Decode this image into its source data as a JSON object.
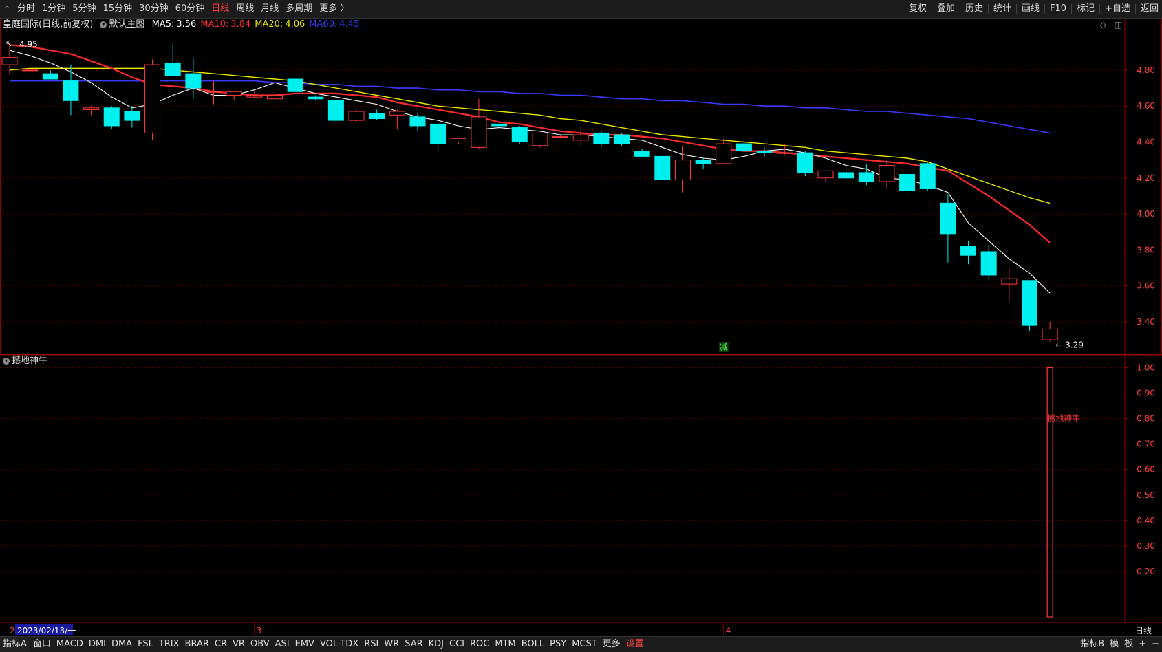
{
  "topbar": {
    "back_glyph": "⌃",
    "periods": [
      "分时",
      "1分钟",
      "5分钟",
      "15分钟",
      "30分钟",
      "60分钟",
      "日线",
      "周线",
      "月线",
      "多周期",
      "更多 〉"
    ],
    "active_period": "日线",
    "tools": [
      "复权",
      "叠加",
      "历史",
      "统计",
      "画线",
      "F10",
      "标记",
      "+自选",
      "返回"
    ]
  },
  "main_legend": {
    "title": "皇庭国际(日线,前复权)",
    "template": "默认主图",
    "ma": [
      {
        "label": "MA5:",
        "value": "3.56",
        "color": "#ffffff"
      },
      {
        "label": "MA10:",
        "value": "3.84",
        "color": "#ff2a2a"
      },
      {
        "label": "MA20:",
        "value": "4.06",
        "color": "#e8e800"
      },
      {
        "label": "MA60:",
        "value": "4.45",
        "color": "#3a3aff"
      }
    ],
    "icon_diamond": "◇",
    "icon_window": "◫"
  },
  "sub_legend": {
    "title": "撼地神牛"
  },
  "colors": {
    "up": "#ff3b3b",
    "down": "#00f0f0",
    "grid": "#5a0000",
    "border": "#9a0000",
    "axis_text": "#ff4040",
    "bg": "#000000"
  },
  "chart_data": {
    "type": "candlestick",
    "max_label": "4.95",
    "min_label": "3.29",
    "price_ticks": [
      "4.80",
      "4.60",
      "4.40",
      "4.20",
      "4.00",
      "3.80",
      "3.60",
      "3.40"
    ],
    "price_range": [
      3.22,
      5.01
    ],
    "ma5": [
      4.91,
      4.88,
      4.84,
      4.79,
      4.73,
      4.65,
      4.59,
      4.61,
      4.66,
      4.7,
      4.66,
      4.66,
      4.69,
      4.73,
      4.7,
      4.67,
      4.65,
      4.63,
      4.61,
      4.57,
      4.54,
      4.52,
      4.49,
      4.47,
      4.48,
      4.47,
      4.46,
      4.44,
      4.44,
      4.43,
      4.42,
      4.41,
      4.37,
      4.33,
      4.31,
      4.3,
      4.32,
      4.35,
      4.36,
      4.34,
      4.31,
      4.27,
      4.25,
      4.2,
      4.19,
      4.16,
      4.12,
      3.95,
      3.85,
      3.75,
      3.67,
      3.56
    ],
    "ma10": [
      4.94,
      4.93,
      4.91,
      4.89,
      4.85,
      4.81,
      4.76,
      4.72,
      4.71,
      4.7,
      4.68,
      4.67,
      4.66,
      4.66,
      4.67,
      4.67,
      4.67,
      4.66,
      4.65,
      4.62,
      4.6,
      4.58,
      4.56,
      4.54,
      4.51,
      4.5,
      4.48,
      4.46,
      4.45,
      4.44,
      4.44,
      4.43,
      4.42,
      4.4,
      4.38,
      4.36,
      4.35,
      4.35,
      4.34,
      4.33,
      4.32,
      4.31,
      4.3,
      4.29,
      4.28,
      4.26,
      4.24,
      4.17,
      4.1,
      4.02,
      3.94,
      3.84
    ],
    "ma20": [
      4.8,
      4.81,
      4.81,
      4.81,
      4.81,
      4.81,
      4.81,
      4.81,
      4.8,
      4.79,
      4.78,
      4.77,
      4.76,
      4.75,
      4.74,
      4.72,
      4.7,
      4.68,
      4.66,
      4.64,
      4.62,
      4.6,
      4.59,
      4.58,
      4.57,
      4.56,
      4.55,
      4.53,
      4.52,
      4.5,
      4.48,
      4.46,
      4.44,
      4.43,
      4.42,
      4.41,
      4.4,
      4.39,
      4.38,
      4.37,
      4.35,
      4.34,
      4.33,
      4.32,
      4.31,
      4.29,
      4.25,
      4.21,
      4.17,
      4.13,
      4.09,
      4.06
    ],
    "ma60": [
      4.74,
      4.74,
      4.74,
      4.74,
      4.74,
      4.74,
      4.74,
      4.74,
      4.74,
      4.74,
      4.74,
      4.74,
      4.74,
      4.73,
      4.73,
      4.72,
      4.72,
      4.71,
      4.71,
      4.7,
      4.7,
      4.69,
      4.69,
      4.68,
      4.68,
      4.67,
      4.67,
      4.66,
      4.66,
      4.65,
      4.64,
      4.64,
      4.63,
      4.63,
      4.62,
      4.61,
      4.61,
      4.6,
      4.6,
      4.59,
      4.59,
      4.58,
      4.57,
      4.57,
      4.56,
      4.55,
      4.54,
      4.53,
      4.51,
      4.49,
      4.47,
      4.45
    ],
    "candles": [
      {
        "o": 4.83,
        "h": 4.95,
        "l": 4.78,
        "c": 4.87
      },
      {
        "o": 4.8,
        "h": 4.82,
        "l": 4.77,
        "c": 4.8
      },
      {
        "o": 4.78,
        "h": 4.8,
        "l": 4.75,
        "c": 4.75
      },
      {
        "o": 4.74,
        "h": 4.83,
        "l": 4.55,
        "c": 4.63
      },
      {
        "o": 4.58,
        "h": 4.6,
        "l": 4.55,
        "c": 4.59
      },
      {
        "o": 4.59,
        "h": 4.6,
        "l": 4.47,
        "c": 4.49
      },
      {
        "o": 4.57,
        "h": 4.6,
        "l": 4.48,
        "c": 4.52
      },
      {
        "o": 4.45,
        "h": 4.86,
        "l": 4.41,
        "c": 4.83
      },
      {
        "o": 4.84,
        "h": 4.95,
        "l": 4.77,
        "c": 4.77
      },
      {
        "o": 4.78,
        "h": 4.87,
        "l": 4.64,
        "c": 4.7
      },
      {
        "o": 4.68,
        "h": 4.74,
        "l": 4.61,
        "c": 4.68
      },
      {
        "o": 4.66,
        "h": 4.68,
        "l": 4.63,
        "c": 4.68
      },
      {
        "o": 4.65,
        "h": 4.68,
        "l": 4.64,
        "c": 4.66
      },
      {
        "o": 4.64,
        "h": 4.67,
        "l": 4.61,
        "c": 4.66
      },
      {
        "o": 4.75,
        "h": 4.75,
        "l": 4.68,
        "c": 4.68
      },
      {
        "o": 4.65,
        "h": 4.66,
        "l": 4.63,
        "c": 4.64
      },
      {
        "o": 4.63,
        "h": 4.64,
        "l": 4.51,
        "c": 4.52
      },
      {
        "o": 4.52,
        "h": 4.58,
        "l": 4.51,
        "c": 4.57
      },
      {
        "o": 4.56,
        "h": 4.58,
        "l": 4.52,
        "c": 4.53
      },
      {
        "o": 4.55,
        "h": 4.58,
        "l": 4.47,
        "c": 4.57
      },
      {
        "o": 4.54,
        "h": 4.56,
        "l": 4.46,
        "c": 4.49
      },
      {
        "o": 4.5,
        "h": 4.5,
        "l": 4.35,
        "c": 4.39
      },
      {
        "o": 4.4,
        "h": 4.42,
        "l": 4.39,
        "c": 4.42
      },
      {
        "o": 4.37,
        "h": 4.64,
        "l": 4.36,
        "c": 4.54
      },
      {
        "o": 4.5,
        "h": 4.53,
        "l": 4.49,
        "c": 4.49
      },
      {
        "o": 4.48,
        "h": 4.49,
        "l": 4.39,
        "c": 4.4
      },
      {
        "o": 4.38,
        "h": 4.45,
        "l": 4.37,
        "c": 4.45
      },
      {
        "o": 4.43,
        "h": 4.44,
        "l": 4.42,
        "c": 4.43
      },
      {
        "o": 4.41,
        "h": 4.49,
        "l": 4.38,
        "c": 4.44
      },
      {
        "o": 4.45,
        "h": 4.46,
        "l": 4.37,
        "c": 4.39
      },
      {
        "o": 4.44,
        "h": 4.45,
        "l": 4.38,
        "c": 4.39
      },
      {
        "o": 4.35,
        "h": 4.36,
        "l": 4.32,
        "c": 4.32
      },
      {
        "o": 4.32,
        "h": 4.32,
        "l": 4.19,
        "c": 4.19
      },
      {
        "o": 4.19,
        "h": 4.38,
        "l": 4.12,
        "c": 4.3
      },
      {
        "o": 4.3,
        "h": 4.31,
        "l": 4.25,
        "c": 4.28
      },
      {
        "o": 4.28,
        "h": 4.42,
        "l": 4.28,
        "c": 4.39
      },
      {
        "o": 4.39,
        "h": 4.42,
        "l": 4.35,
        "c": 4.35
      },
      {
        "o": 4.35,
        "h": 4.37,
        "l": 4.32,
        "c": 4.34
      },
      {
        "o": 4.34,
        "h": 4.39,
        "l": 4.33,
        "c": 4.34
      },
      {
        "o": 4.34,
        "h": 4.35,
        "l": 4.21,
        "c": 4.23
      },
      {
        "o": 4.2,
        "h": 4.24,
        "l": 4.18,
        "c": 4.24
      },
      {
        "o": 4.23,
        "h": 4.26,
        "l": 4.19,
        "c": 4.2
      },
      {
        "o": 4.23,
        "h": 4.28,
        "l": 4.16,
        "c": 4.18
      },
      {
        "o": 4.18,
        "h": 4.3,
        "l": 4.14,
        "c": 4.27
      },
      {
        "o": 4.22,
        "h": 4.23,
        "l": 4.11,
        "c": 4.13
      },
      {
        "o": 4.28,
        "h": 4.29,
        "l": 4.13,
        "c": 4.14
      },
      {
        "o": 4.06,
        "h": 4.11,
        "l": 3.73,
        "c": 3.89
      },
      {
        "o": 3.82,
        "h": 3.85,
        "l": 3.72,
        "c": 3.77
      },
      {
        "o": 3.79,
        "h": 3.83,
        "l": 3.64,
        "c": 3.66
      },
      {
        "o": 3.61,
        "h": 3.7,
        "l": 3.51,
        "c": 3.64
      },
      {
        "o": 3.63,
        "h": 3.63,
        "l": 3.35,
        "c": 3.38
      },
      {
        "o": 3.3,
        "h": 3.4,
        "l": 3.29,
        "c": 3.36
      }
    ],
    "marker_label": "减",
    "marker_index": 35,
    "indicator_name": "撼地神牛",
    "indicator_ticks": [
      "1.00",
      "0.90",
      "0.80",
      "0.70",
      "0.60",
      "0.50",
      "0.40",
      "0.30",
      "0.20"
    ],
    "indicator_range": [
      0,
      1.05
    ],
    "indicator_signal_index": 51,
    "indicator_signal_value": 1.0,
    "date_label": "2023/02/13/一",
    "month_labels": [
      {
        "index": 12,
        "text": "3"
      },
      {
        "index": 35,
        "text": "4"
      }
    ],
    "date_first_char": "2",
    "period_label": "日线"
  },
  "bottombar": {
    "left_label": "指标A",
    "items": [
      "窗口",
      "MACD",
      "DMI",
      "DMA",
      "FSL",
      "TRIX",
      "BRAR",
      "CR",
      "VR",
      "OBV",
      "ASI",
      "EMV",
      "VOL-TDX",
      "RSI",
      "WR",
      "SAR",
      "KDJ",
      "CCI",
      "ROC",
      "MTM",
      "BOLL",
      "PSY",
      "MCST",
      "更多",
      "设置"
    ],
    "active": "设置",
    "right_items": [
      "指标B",
      "模",
      "板"
    ],
    "plus": "+",
    "minus": "−"
  }
}
